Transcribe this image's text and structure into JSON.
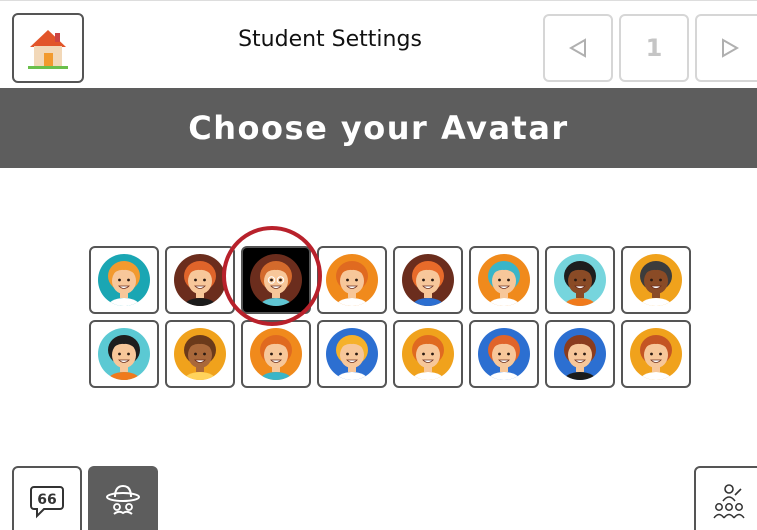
{
  "header": {
    "title": "Student Settings",
    "page_number": "1",
    "home_icon": "house-icon",
    "prev_icon": "triangle-left-icon",
    "next_icon": "triangle-right-icon"
  },
  "banner": {
    "title": "Choose your Avatar"
  },
  "avatars": {
    "selected_index": 2,
    "selection_ring_color": "#b8212b",
    "items": [
      {
        "name": "boy-blonde",
        "bg": "#1aa6b3",
        "hair": "#f29a2e",
        "skin": "#f7c79a",
        "shirt": "#ffffff"
      },
      {
        "name": "boy-redhead",
        "bg": "#6b2d1d",
        "hair": "#e0642a",
        "skin": "#f7c79a",
        "shirt": "#1b1b1b"
      },
      {
        "name": "boy-glasses",
        "bg": "#6b2d1d",
        "hair": "#d36a2c",
        "skin": "#f7c79a",
        "shirt": "#5fc5d3"
      },
      {
        "name": "boy-orange-hair",
        "bg": "#f08a1c",
        "hair": "#e06a20",
        "skin": "#f7c79a",
        "shirt": "#ffffff"
      },
      {
        "name": "boy-striped",
        "bg": "#6b2d1d",
        "hair": "#e86b2a",
        "skin": "#f7c79a",
        "shirt": "#2c6fd1"
      },
      {
        "name": "boy-cap",
        "bg": "#f08a1c",
        "hair": "#39b5c8",
        "skin": "#f7c79a",
        "shirt": "#ffffff"
      },
      {
        "name": "boy-curly",
        "bg": "#76d5dd",
        "hair": "#1e1e1e",
        "skin": "#8a4b26",
        "shirt": "#f07a1c"
      },
      {
        "name": "boy-beanie",
        "bg": "#f0a21c",
        "hair": "#3c3c3c",
        "skin": "#8a4b26",
        "shirt": "#ffffff"
      },
      {
        "name": "girl-black-hair",
        "bg": "#5bc9d3",
        "hair": "#1e1e1e",
        "skin": "#f7c79a",
        "shirt": "#f07a1c"
      },
      {
        "name": "girl-pigtails",
        "bg": "#f0a21c",
        "hair": "#6b3a1a",
        "skin": "#a9683a",
        "shirt": "#ffd35c"
      },
      {
        "name": "girl-bun",
        "bg": "#f08a1c",
        "hair": "#e06a20",
        "skin": "#f7c79a",
        "shirt": "#39b5c8"
      },
      {
        "name": "girl-blonde",
        "bg": "#2c6fd1",
        "hair": "#f5b12a",
        "skin": "#f7c79a",
        "shirt": "#ffffff"
      },
      {
        "name": "girl-red-bob",
        "bg": "#f0a21c",
        "hair": "#e06a20",
        "skin": "#f7c79a",
        "shirt": "#ffffff"
      },
      {
        "name": "girl-topknot",
        "bg": "#2c6fd1",
        "hair": "#e0642a",
        "skin": "#f7c79a",
        "shirt": "#ffffff"
      },
      {
        "name": "girl-brown-hair",
        "bg": "#2c6fd1",
        "hair": "#8a3c1e",
        "skin": "#f7c79a",
        "shirt": "#1b1b1b"
      },
      {
        "name": "girl-long-hair",
        "bg": "#f0a21c",
        "hair": "#c45524",
        "skin": "#f7c79a",
        "shirt": "#ffffff"
      }
    ]
  },
  "footer": {
    "quote_icon": "speech-quote-icon",
    "disguise_icon": "hat-mustache-icon",
    "class_icon": "group-people-icon"
  }
}
